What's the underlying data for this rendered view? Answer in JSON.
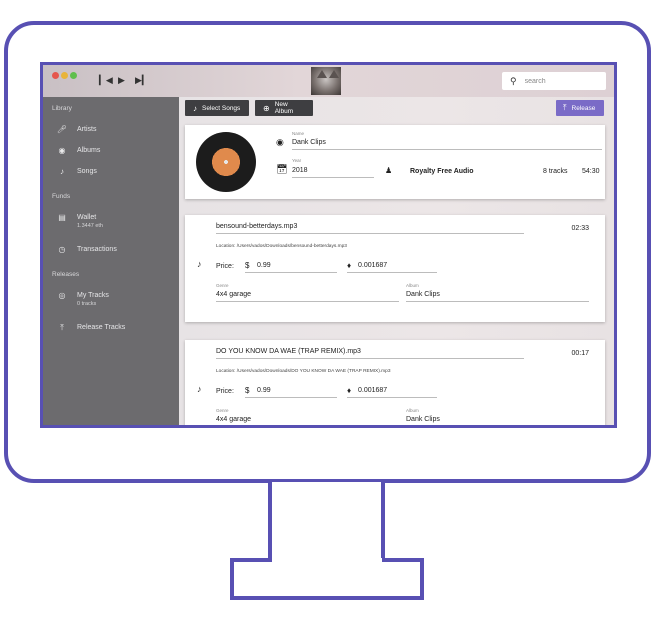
{
  "titlebar": {
    "prev_icon": "skip-back-icon",
    "play_icon": "play-icon",
    "next_icon": "skip-forward-icon",
    "search_placeholder": "search"
  },
  "sidebar": {
    "library_label": "Library",
    "library_items": [
      {
        "label": "Artists",
        "icon": "mic-icon"
      },
      {
        "label": "Albums",
        "icon": "disc-icon"
      },
      {
        "label": "Songs",
        "icon": "music-note-icon"
      }
    ],
    "funds_label": "Funds",
    "wallet": {
      "label": "Wallet",
      "balance": "1.3447 eth",
      "icon": "wallet-icon"
    },
    "transactions": {
      "label": "Transactions",
      "icon": "history-icon"
    },
    "releases_label": "Releases",
    "my_tracks": {
      "label": "My Tracks",
      "count": "0 tracks",
      "icon": "radar-icon"
    },
    "release_tracks": {
      "label": "Release Tracks",
      "icon": "upload-icon"
    }
  },
  "toolbar": {
    "select_songs": "Select Songs",
    "new_album": "New Album",
    "release": "Release"
  },
  "album": {
    "name_caption": "Name",
    "name": "Dank Clips",
    "year_caption": "Year",
    "year": "2018",
    "artist": "Royalty Free Audio",
    "tracks": "8 tracks",
    "duration": "54:30"
  },
  "tracks": [
    {
      "title": "bensound-betterdays.mp3",
      "duration": "02:33",
      "location": "Location: /Users/vados/Downloads/bensound-betterdays.mp3",
      "price_label": "Price:",
      "price_usd": "0.99",
      "price_eth": "0.001687",
      "genre_caption": "Genre",
      "genre": "4x4 garage",
      "album_caption": "Album",
      "album": "Dank Clips"
    },
    {
      "title": "DO YOU KNOW DA WAE (TRAP REMIX).mp3",
      "duration": "00:17",
      "location": "Location: /Users/vados/Downloads/DO YOU KNOW DA WAE (TRAP REMIX).mp3",
      "price_label": "Price:",
      "price_usd": "0.99",
      "price_eth": "0.001687",
      "genre_caption": "Genre",
      "genre": "4x4 garage",
      "album_caption": "Album",
      "album": "Dank Clips"
    }
  ],
  "colors": {
    "frame": "#5850b3",
    "sidebar": "#6c6b6e",
    "toolbar_button": "#3e3e41",
    "release_button": "#7a6bc7",
    "vinyl_label": "#e08a4c"
  }
}
